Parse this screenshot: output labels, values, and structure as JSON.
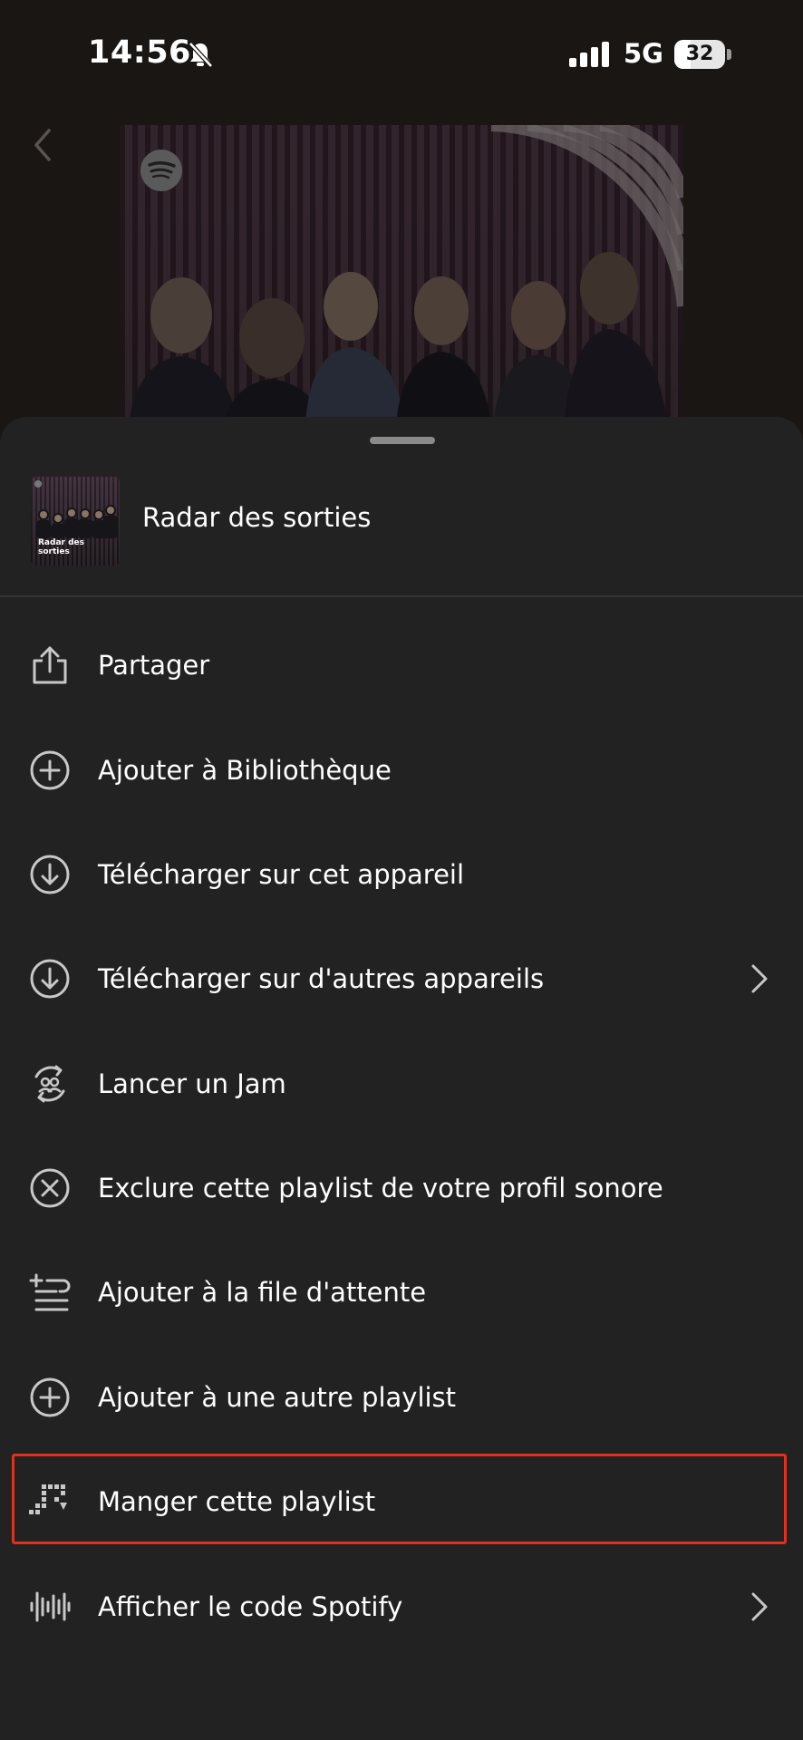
{
  "status_bar": {
    "time": "14:56",
    "network": "5G",
    "battery": "32"
  },
  "header": {
    "title": "Radar des sorties",
    "thumb_caption": "Radar des sorties"
  },
  "menu": {
    "items": [
      {
        "label": "Partager",
        "icon": "share-icon"
      },
      {
        "label": "Ajouter à Bibliothèque",
        "icon": "add-circle-icon"
      },
      {
        "label": "Télécharger sur cet appareil",
        "icon": "download-circle-icon"
      },
      {
        "label": "Télécharger sur d'autres appareils",
        "icon": "download-circle-icon"
      },
      {
        "label": "Lancer un Jam",
        "icon": "jam-icon"
      },
      {
        "label": "Exclure cette playlist de votre profil sonore",
        "icon": "exclude-circle-icon"
      },
      {
        "label": "Ajouter à la file d'attente",
        "icon": "add-to-queue-icon"
      },
      {
        "label": "Ajouter à une autre playlist",
        "icon": "add-circle-icon"
      },
      {
        "label": "Manger cette playlist",
        "icon": "playlist-blocks-icon"
      },
      {
        "label": "Afficher le code Spotify",
        "icon": "spotify-code-icon"
      }
    ]
  },
  "colors": {
    "sheet_bg": "#222222",
    "page_bg": "#1a1614",
    "highlight": "#e0301e",
    "text": "#ffffff",
    "icon": "#c8c8c8"
  }
}
